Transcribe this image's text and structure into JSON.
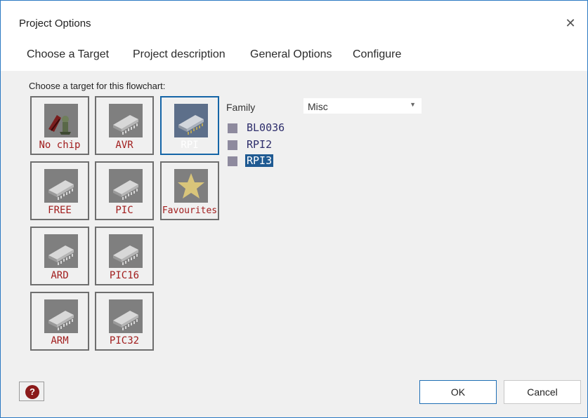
{
  "window": {
    "title": "Project Options"
  },
  "tabs": [
    {
      "label": "Choose a Target"
    },
    {
      "label": "Project description"
    },
    {
      "label": "General Options"
    },
    {
      "label": "Configure"
    }
  ],
  "target": {
    "prompt": "Choose a target for this flowchart:",
    "tiles": [
      {
        "label": "No chip",
        "icon": "no-chip-icon"
      },
      {
        "label": "AVR",
        "icon": "chip-icon"
      },
      {
        "label": "RPI",
        "icon": "chip-icon",
        "selected": true
      },
      {
        "label": "FREE",
        "icon": "chip-icon"
      },
      {
        "label": "PIC",
        "icon": "chip-icon"
      },
      {
        "label": "Favourites",
        "icon": "star-icon"
      },
      {
        "label": "ARD",
        "icon": "chip-icon"
      },
      {
        "label": "PIC16",
        "icon": "chip-icon"
      },
      {
        "label": "ARM",
        "icon": "chip-icon"
      },
      {
        "label": "PIC32",
        "icon": "chip-icon"
      }
    ]
  },
  "family": {
    "label": "Family",
    "selected": "Misc"
  },
  "chips": [
    {
      "name": "BL0036"
    },
    {
      "name": "RPI2"
    },
    {
      "name": "RPI3",
      "selected": true
    }
  ],
  "buttons": {
    "help": "?",
    "ok": "OK",
    "cancel": "Cancel"
  },
  "colors": {
    "tile_label": "#a11d1d",
    "selection": "#1f5a92",
    "window_border": "#2b79c2"
  }
}
